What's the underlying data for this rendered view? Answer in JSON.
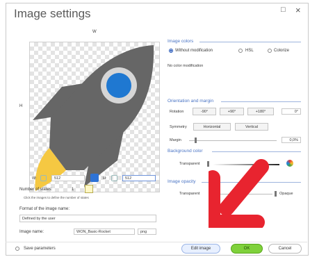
{
  "window": {
    "title": "Image settings",
    "maximize_glyph": "□",
    "close_glyph": "×"
  },
  "canvas": {
    "width_axis_label": "W",
    "height_axis_label": "H",
    "width_field_label": "W:",
    "width_value": "512",
    "height_field_label": "H:",
    "height_value": "512",
    "rocket_body_color": "#666666",
    "rocket_window_color": "#1f78d1",
    "flame_color": "#f5c842"
  },
  "states": {
    "label": "Number of states:",
    "value": "1",
    "hint": "Click the images to define the number of states"
  },
  "image_name_format": {
    "label": "Format of the image name:",
    "selected": "Defined by the user"
  },
  "image_name": {
    "label": "Image name:",
    "value": "WON_Basic-Rocket",
    "extension": "png"
  },
  "image_colors": {
    "header": "Image colors",
    "options": [
      "Without modification",
      "HSL",
      "Colorize"
    ],
    "selected_index": 0,
    "status": "No color modification"
  },
  "orientation": {
    "header": "Orientation and margin",
    "rotation_label": "Rotation",
    "rotation_buttons": [
      "-90°",
      "+90°",
      "+180°"
    ],
    "rotation_value": "0°",
    "symmetry_label": "Symmetry",
    "symmetry_buttons": [
      "Horizontal",
      "Vertical"
    ],
    "margin_label": "Margin",
    "margin_value": "0,0%"
  },
  "background_color": {
    "header": "Background color",
    "label": "Transparent",
    "picker_icon": "color-picker-icon"
  },
  "image_opacity": {
    "header": "Image opacity",
    "left_label": "Transparent",
    "right_label": "Opaque"
  },
  "footer": {
    "save_params_label": "Save parameters",
    "edit_label": "Edit image",
    "ok_label": "OK",
    "cancel_label": "Cancel"
  },
  "overlay": {
    "arrow_color": "#e8242f",
    "arrow_icon": "arrow-down-left-icon"
  }
}
